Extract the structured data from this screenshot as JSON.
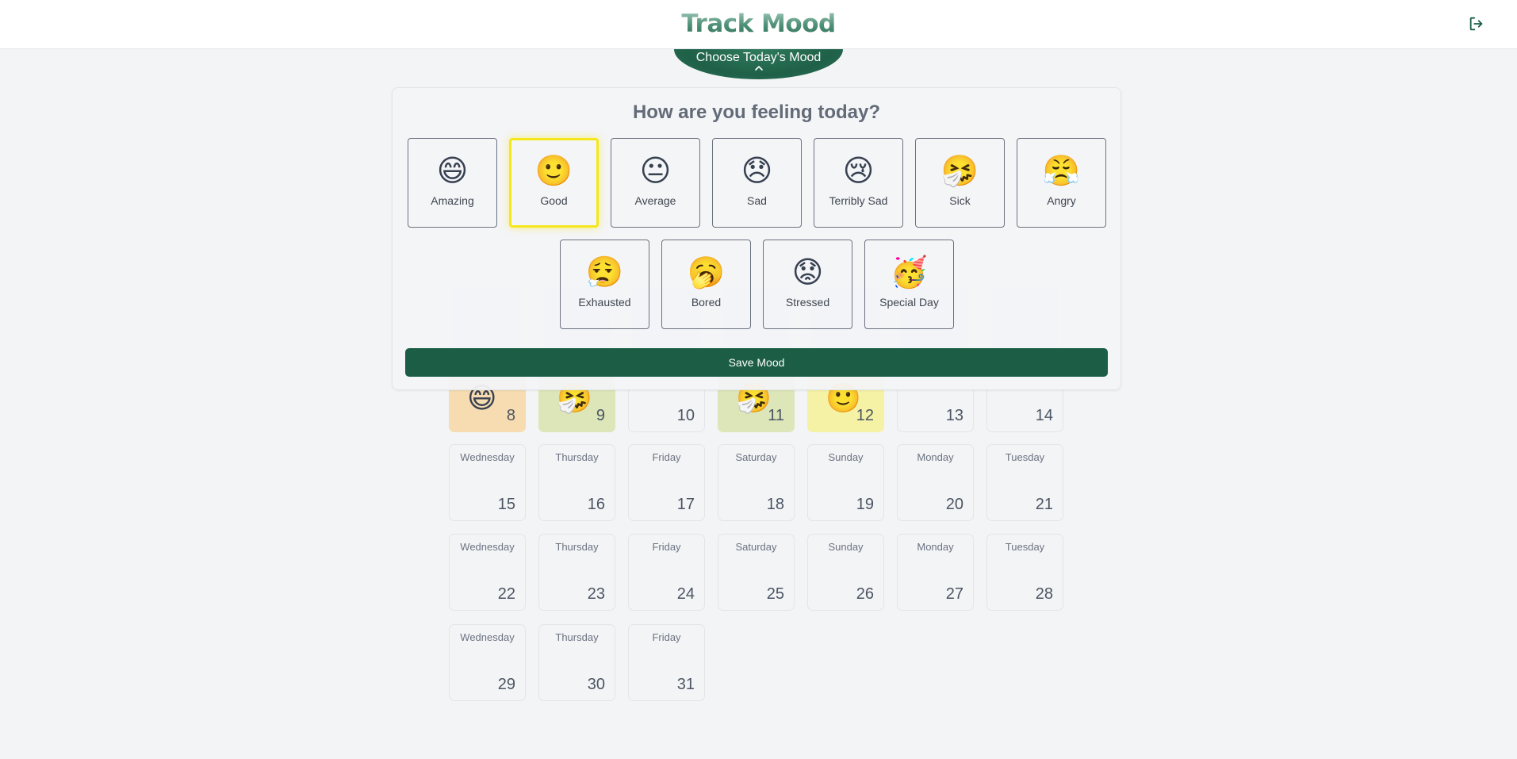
{
  "app": {
    "title": "Track Mood"
  },
  "header": {
    "logout_icon": "logout-icon",
    "mood_tab_label": "Choose Today's Mood",
    "mood_tab_icon": "chevron-up-icon"
  },
  "colors": {
    "brand_green": "#1b5e45",
    "selected_border": "#f5e71b",
    "amazing_bg": "#f6dcb0",
    "sick_bg": "#dce6b8",
    "good_bg": "#f5f2a5"
  },
  "picker": {
    "title": "How are you feeling today?",
    "selected": "Good",
    "moods": [
      {
        "label": "Amazing",
        "emoji": "😄"
      },
      {
        "label": "Good",
        "emoji": "🙂"
      },
      {
        "label": "Average",
        "emoji": "😐"
      },
      {
        "label": "Sad",
        "emoji": "😞"
      },
      {
        "label": "Terribly Sad",
        "emoji": "😢"
      },
      {
        "label": "Sick",
        "emoji": "🤧"
      },
      {
        "label": "Angry",
        "emoji": "😤"
      },
      {
        "label": "Exhausted",
        "emoji": "😮‍💨"
      },
      {
        "label": "Bored",
        "emoji": "🥱"
      },
      {
        "label": "Stressed",
        "emoji": "😟"
      },
      {
        "label": "Special Day",
        "emoji": "🥳"
      }
    ],
    "save_label": "Save Mood"
  },
  "calendar": {
    "row_8": [
      {
        "num": "8",
        "emoji": "😄",
        "mood": "Amazing"
      },
      {
        "num": "9",
        "emoji": "🤧",
        "mood": "Sick"
      },
      {
        "num": "10",
        "emoji": "",
        "mood": ""
      },
      {
        "num": "11",
        "emoji": "🤧",
        "mood": "Sick"
      },
      {
        "num": "12",
        "emoji": "🙂",
        "mood": "Good"
      },
      {
        "num": "13",
        "emoji": "",
        "mood": ""
      },
      {
        "num": "14",
        "emoji": "",
        "mood": ""
      }
    ],
    "weeks": [
      [
        {
          "day": "Wednesday",
          "num": "15"
        },
        {
          "day": "Thursday",
          "num": "16"
        },
        {
          "day": "Friday",
          "num": "17"
        },
        {
          "day": "Saturday",
          "num": "18"
        },
        {
          "day": "Sunday",
          "num": "19"
        },
        {
          "day": "Monday",
          "num": "20"
        },
        {
          "day": "Tuesday",
          "num": "21"
        }
      ],
      [
        {
          "day": "Wednesday",
          "num": "22"
        },
        {
          "day": "Thursday",
          "num": "23"
        },
        {
          "day": "Friday",
          "num": "24"
        },
        {
          "day": "Saturday",
          "num": "25"
        },
        {
          "day": "Sunday",
          "num": "26"
        },
        {
          "day": "Monday",
          "num": "27"
        },
        {
          "day": "Tuesday",
          "num": "28"
        }
      ],
      [
        {
          "day": "Wednesday",
          "num": "29"
        },
        {
          "day": "Thursday",
          "num": "30"
        },
        {
          "day": "Friday",
          "num": "31"
        }
      ]
    ]
  }
}
